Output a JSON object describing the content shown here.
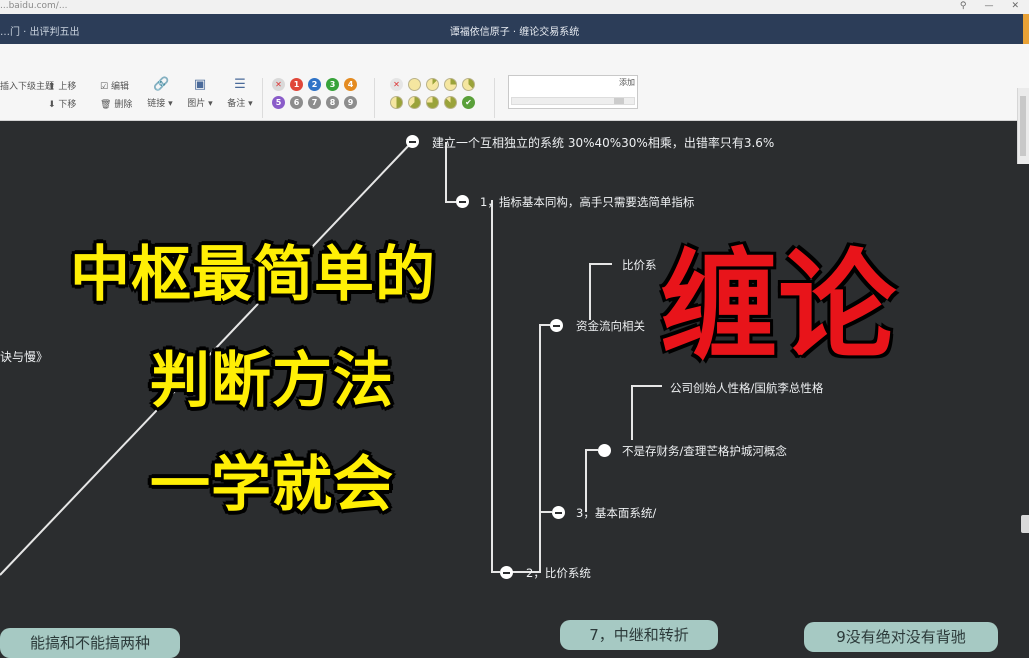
{
  "browser": {
    "url": "...baidu.com/...",
    "controls": [
      "⚲",
      "—",
      "✕"
    ]
  },
  "titlebar": {
    "crumb": "…门 · 出评判五出",
    "title": "谭福依信原子 · 缠论交易系统"
  },
  "toolbar": {
    "insert_child": "插入下级主题",
    "move_up": "上移",
    "move_down": "下移",
    "edit": "编辑",
    "delete": "删除",
    "link": "链接 ▾",
    "image": "图片 ▾",
    "note": "备注 ▾",
    "priority": [
      "✕",
      "1",
      "2",
      "3",
      "4",
      "5",
      "6",
      "7",
      "8",
      "9"
    ],
    "progress_close": "✕",
    "search_add": "添加"
  },
  "mindmap": {
    "root": "建立一个互相独立的系统 30%40%30%相乘，出错率只有3.6%",
    "n1": "1，指标基本同构，高手只需要选简单指标",
    "n_bj": "比价系",
    "n_zj": "资金流向相关",
    "n_gs": "公司创始人性格/国航李总性格",
    "n_cw": "不是存财务/查理芒格护城河概念",
    "n3": "3，基本面系统/",
    "n2": "2，比价系统",
    "left_fragment": "诀与慢》",
    "box1": "7，中继和转折",
    "box2": "9没有绝对没有背驰",
    "box_left": "能搞和不能搞两种"
  },
  "overlay": {
    "line1": "中枢最简单的",
    "line2": "判断方法",
    "line3": "一学就会",
    "red": "缠论"
  },
  "colors": {
    "yellow_overlay": "#ffef05",
    "red_overlay": "#e8141a",
    "canvas_bg": "#2b2d2f",
    "titlebar_bg": "#2c3d58"
  }
}
